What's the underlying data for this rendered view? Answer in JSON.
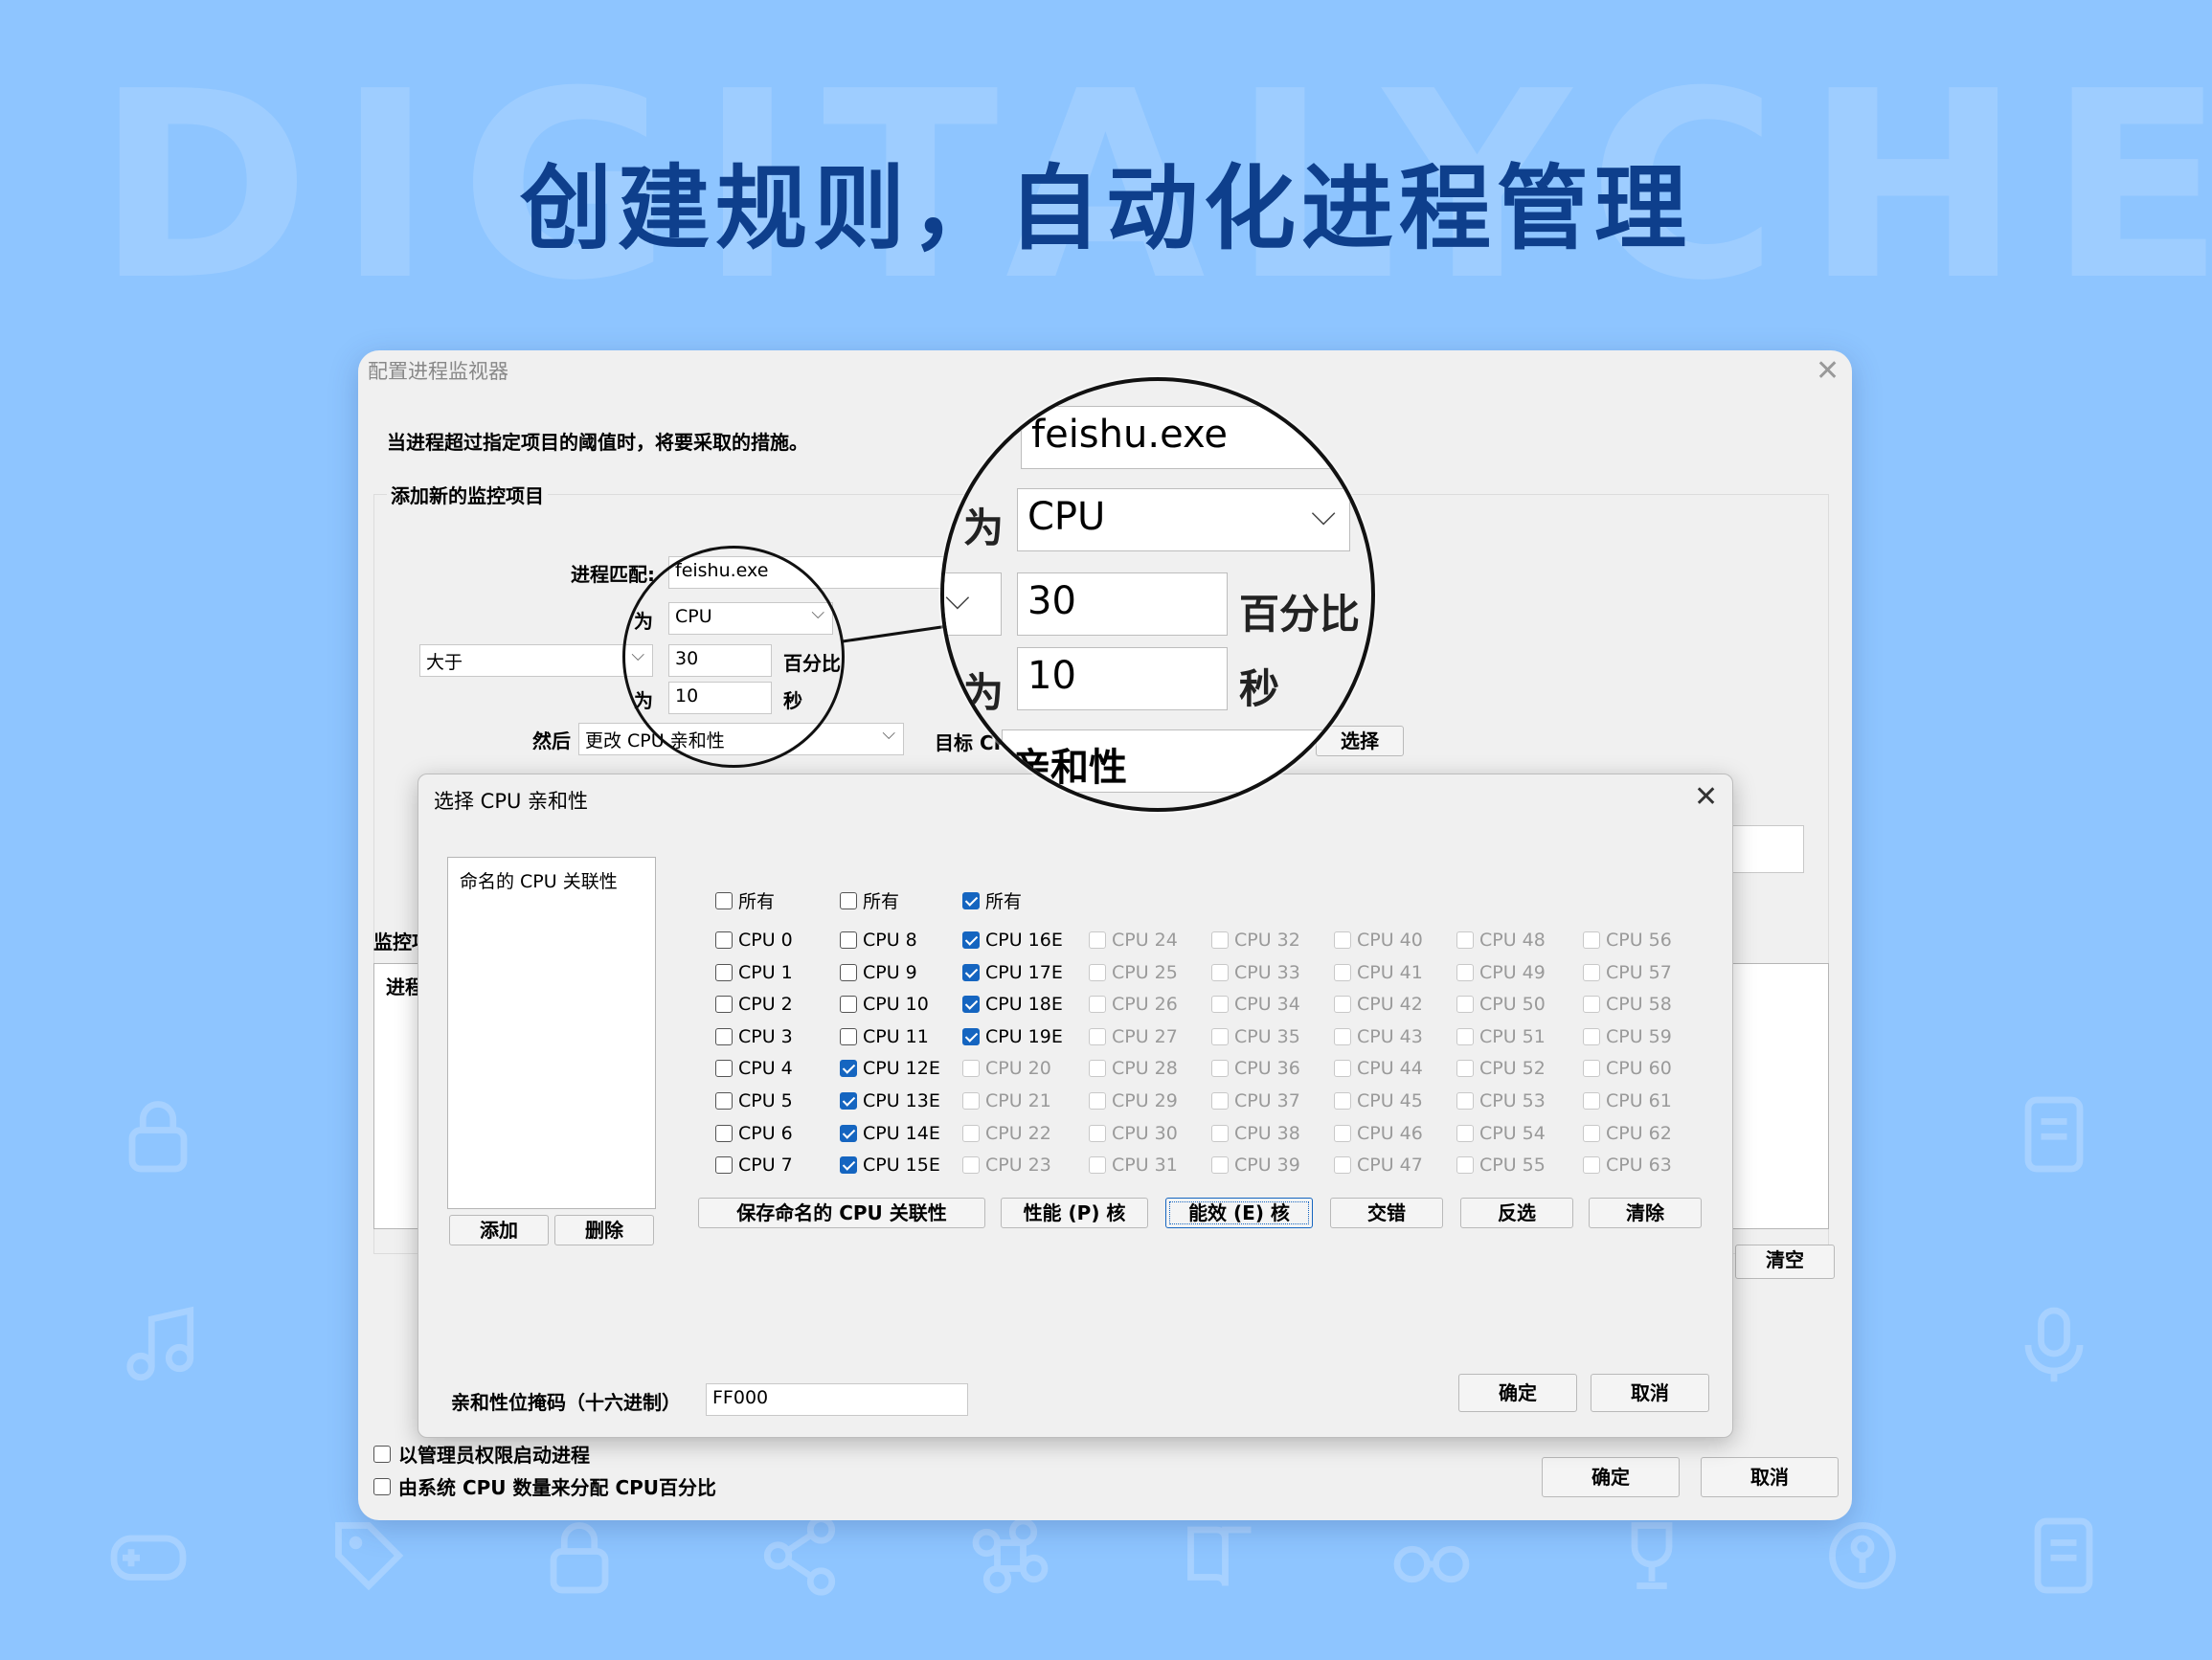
{
  "background": {
    "watermark": "DIGITALYCHEE",
    "headline": "创建规则，自动化进程管理"
  },
  "main_window": {
    "title": "配置进程监视器",
    "description": "当进程超过指定项目的阈值时，将要采取的措施。",
    "add_group_label": "添加新的监控项目",
    "process_match_label": "进程匹配:",
    "process_match_value": "feishu.exe",
    "for_label": "为",
    "metric_value": "CPU",
    "comparison_value": "大于",
    "threshold_value": "30",
    "threshold_unit": "百分比",
    "duration_for_label": "为",
    "duration_value": "10",
    "duration_unit": "秒",
    "then_label": "然后",
    "action_value": "更改 CPU 亲和性",
    "target_label": "目标 CPU",
    "select_button": "选择",
    "monitor_label": "监控项目",
    "process_column": "进程",
    "clear_button": "清空",
    "admin_checkbox": "以管理员权限启动进程",
    "system_cpu_checkbox": "由系统 CPU 数量来分配 CPU百分比",
    "ok_button": "确定",
    "cancel_button": "取消"
  },
  "magnifier": {
    "process": "feishu.exe",
    "for_label": "为",
    "metric": "CPU",
    "threshold": "30",
    "threshold_unit": "百分比",
    "duration_for": "为",
    "duration": "10",
    "duration_unit": "秒",
    "action_partial": "亲和性"
  },
  "affinity_dialog": {
    "title": "选择 CPU 亲和性",
    "named_list_header": "命名的 CPU 关联性",
    "add_button": "添加",
    "delete_button": "删除",
    "all_label": "所有",
    "columns": [
      {
        "all_checked": false,
        "items": [
          {
            "label": "CPU 0",
            "checked": false,
            "enabled": true
          },
          {
            "label": "CPU 1",
            "checked": false,
            "enabled": true
          },
          {
            "label": "CPU 2",
            "checked": false,
            "enabled": true
          },
          {
            "label": "CPU 3",
            "checked": false,
            "enabled": true
          },
          {
            "label": "CPU 4",
            "checked": false,
            "enabled": true
          },
          {
            "label": "CPU 5",
            "checked": false,
            "enabled": true
          },
          {
            "label": "CPU 6",
            "checked": false,
            "enabled": true
          },
          {
            "label": "CPU 7",
            "checked": false,
            "enabled": true
          }
        ]
      },
      {
        "all_checked": false,
        "items": [
          {
            "label": "CPU 8",
            "checked": false,
            "enabled": true
          },
          {
            "label": "CPU 9",
            "checked": false,
            "enabled": true
          },
          {
            "label": "CPU 10",
            "checked": false,
            "enabled": true
          },
          {
            "label": "CPU 11",
            "checked": false,
            "enabled": true
          },
          {
            "label": "CPU 12E",
            "checked": true,
            "enabled": true
          },
          {
            "label": "CPU 13E",
            "checked": true,
            "enabled": true
          },
          {
            "label": "CPU 14E",
            "checked": true,
            "enabled": true
          },
          {
            "label": "CPU 15E",
            "checked": true,
            "enabled": true
          }
        ]
      },
      {
        "all_checked": true,
        "items": [
          {
            "label": "CPU 16E",
            "checked": true,
            "enabled": true
          },
          {
            "label": "CPU 17E",
            "checked": true,
            "enabled": true
          },
          {
            "label": "CPU 18E",
            "checked": true,
            "enabled": true
          },
          {
            "label": "CPU 19E",
            "checked": true,
            "enabled": true
          },
          {
            "label": "CPU 20",
            "checked": false,
            "enabled": false
          },
          {
            "label": "CPU 21",
            "checked": false,
            "enabled": false
          },
          {
            "label": "CPU 22",
            "checked": false,
            "enabled": false
          },
          {
            "label": "CPU 23",
            "checked": false,
            "enabled": false
          }
        ]
      },
      {
        "items": [
          {
            "label": "CPU 24",
            "checked": false,
            "enabled": false
          },
          {
            "label": "CPU 25",
            "checked": false,
            "enabled": false
          },
          {
            "label": "CPU 26",
            "checked": false,
            "enabled": false
          },
          {
            "label": "CPU 27",
            "checked": false,
            "enabled": false
          },
          {
            "label": "CPU 28",
            "checked": false,
            "enabled": false
          },
          {
            "label": "CPU 29",
            "checked": false,
            "enabled": false
          },
          {
            "label": "CPU 30",
            "checked": false,
            "enabled": false
          },
          {
            "label": "CPU 31",
            "checked": false,
            "enabled": false
          }
        ]
      },
      {
        "items": [
          {
            "label": "CPU 32",
            "checked": false,
            "enabled": false
          },
          {
            "label": "CPU 33",
            "checked": false,
            "enabled": false
          },
          {
            "label": "CPU 34",
            "checked": false,
            "enabled": false
          },
          {
            "label": "CPU 35",
            "checked": false,
            "enabled": false
          },
          {
            "label": "CPU 36",
            "checked": false,
            "enabled": false
          },
          {
            "label": "CPU 37",
            "checked": false,
            "enabled": false
          },
          {
            "label": "CPU 38",
            "checked": false,
            "enabled": false
          },
          {
            "label": "CPU 39",
            "checked": false,
            "enabled": false
          }
        ]
      },
      {
        "items": [
          {
            "label": "CPU 40",
            "checked": false,
            "enabled": false
          },
          {
            "label": "CPU 41",
            "checked": false,
            "enabled": false
          },
          {
            "label": "CPU 42",
            "checked": false,
            "enabled": false
          },
          {
            "label": "CPU 43",
            "checked": false,
            "enabled": false
          },
          {
            "label": "CPU 44",
            "checked": false,
            "enabled": false
          },
          {
            "label": "CPU 45",
            "checked": false,
            "enabled": false
          },
          {
            "label": "CPU 46",
            "checked": false,
            "enabled": false
          },
          {
            "label": "CPU 47",
            "checked": false,
            "enabled": false
          }
        ]
      },
      {
        "items": [
          {
            "label": "CPU 48",
            "checked": false,
            "enabled": false
          },
          {
            "label": "CPU 49",
            "checked": false,
            "enabled": false
          },
          {
            "label": "CPU 50",
            "checked": false,
            "enabled": false
          },
          {
            "label": "CPU 51",
            "checked": false,
            "enabled": false
          },
          {
            "label": "CPU 52",
            "checked": false,
            "enabled": false
          },
          {
            "label": "CPU 53",
            "checked": false,
            "enabled": false
          },
          {
            "label": "CPU 54",
            "checked": false,
            "enabled": false
          },
          {
            "label": "CPU 55",
            "checked": false,
            "enabled": false
          }
        ]
      },
      {
        "items": [
          {
            "label": "CPU 56",
            "checked": false,
            "enabled": false
          },
          {
            "label": "CPU 57",
            "checked": false,
            "enabled": false
          },
          {
            "label": "CPU 58",
            "checked": false,
            "enabled": false
          },
          {
            "label": "CPU 59",
            "checked": false,
            "enabled": false
          },
          {
            "label": "CPU 60",
            "checked": false,
            "enabled": false
          },
          {
            "label": "CPU 61",
            "checked": false,
            "enabled": false
          },
          {
            "label": "CPU 62",
            "checked": false,
            "enabled": false
          },
          {
            "label": "CPU 63",
            "checked": false,
            "enabled": false
          }
        ]
      }
    ],
    "buttons": {
      "save_named": "保存命名的 CPU 关联性",
      "performance": "性能 (P) 核",
      "efficiency": "能效 (E) 核",
      "interleave": "交错",
      "invert": "反选",
      "clear": "清除"
    },
    "mask_label": "亲和性位掩码（十六进制）",
    "mask_value": "FF000",
    "ok_button": "确定",
    "cancel_button": "取消"
  },
  "colors": {
    "page_bg": "#8ec5ff",
    "headline": "#0e3f8c",
    "check_accent": "#1565c0"
  },
  "decor_icons": [
    "lock-icon",
    "music-note-icon",
    "microphone-icon",
    "gamepad-icon",
    "file-icon",
    "share-icon",
    "command-icon",
    "book-icon",
    "glasses-icon",
    "trophy-icon",
    "key-icon",
    "tag-icon"
  ]
}
